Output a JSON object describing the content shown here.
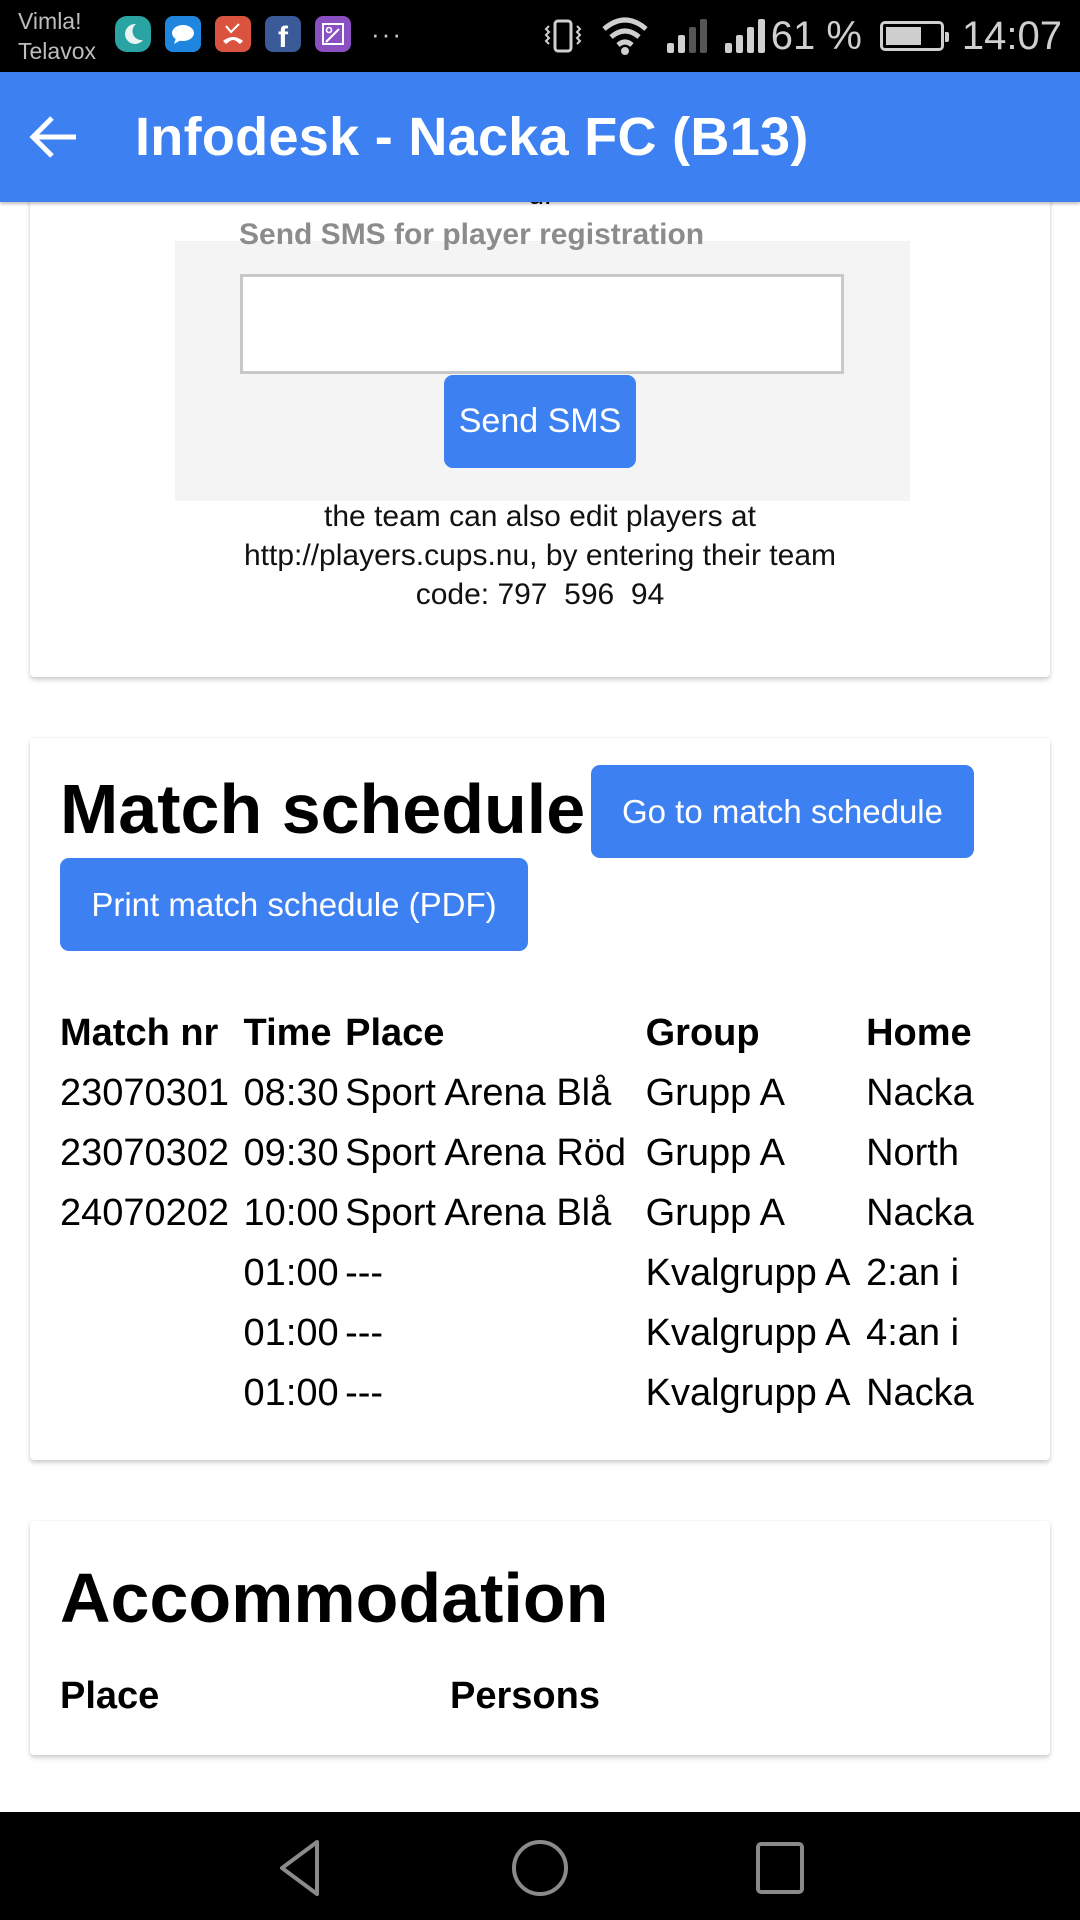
{
  "status_bar": {
    "carrier_line1": "Vimla!",
    "carrier_line2": "Telavox",
    "notification_icons": [
      "moon-app-icon",
      "messages-icon",
      "missed-call-icon",
      "facebook-icon",
      "gallery-icon"
    ],
    "more_indicator": "···",
    "battery_percent_text": "61 %",
    "battery_level": 0.61,
    "time": "14:07"
  },
  "app_bar": {
    "back_icon": "arrow-left-icon",
    "title": "Infodesk - Nacka FC (B13)"
  },
  "registration_card": {
    "cut_off_text": "g.",
    "sms_label": "Send SMS for player registration",
    "sms_input_value": "",
    "sms_input_placeholder": "",
    "send_button": "Send SMS",
    "note_line1": "the team can also edit players at",
    "note_line2": "http://players.cups.nu, by entering their team",
    "note_line3": "code: 797  596  94"
  },
  "match_schedule": {
    "title": "Match schedule",
    "goto_button": "Go to match schedule",
    "print_button": "Print match schedule (PDF)",
    "columns": [
      "Match nr",
      "Time",
      "Place",
      "Group",
      "Home"
    ],
    "rows": [
      [
        "23070301",
        "08:30",
        "Sport Arena Blå",
        "Grupp A",
        "Nacka"
      ],
      [
        "23070302",
        "09:30",
        "Sport Arena Röd",
        "Grupp A",
        "North"
      ],
      [
        "24070202",
        "10:00",
        "Sport Arena Blå",
        "Grupp A",
        "Nacka"
      ],
      [
        "",
        "01:00",
        "---",
        "Kvalgrupp A",
        "2:an i"
      ],
      [
        "",
        "01:00",
        "---",
        "Kvalgrupp A",
        "4:an i"
      ],
      [
        "",
        "01:00",
        "---",
        "Kvalgrupp A",
        "Nacka"
      ]
    ]
  },
  "accommodation": {
    "title": "Accommodation",
    "columns": [
      "Place",
      "Persons"
    ]
  },
  "nav_bar": {
    "back": "nav-back-icon",
    "home": "nav-home-icon",
    "recents": "nav-recents-icon"
  },
  "colors": {
    "primary": "#3c80f2",
    "sms_box_bg": "#f4f4f5",
    "label_gray": "#8c8c8c"
  }
}
